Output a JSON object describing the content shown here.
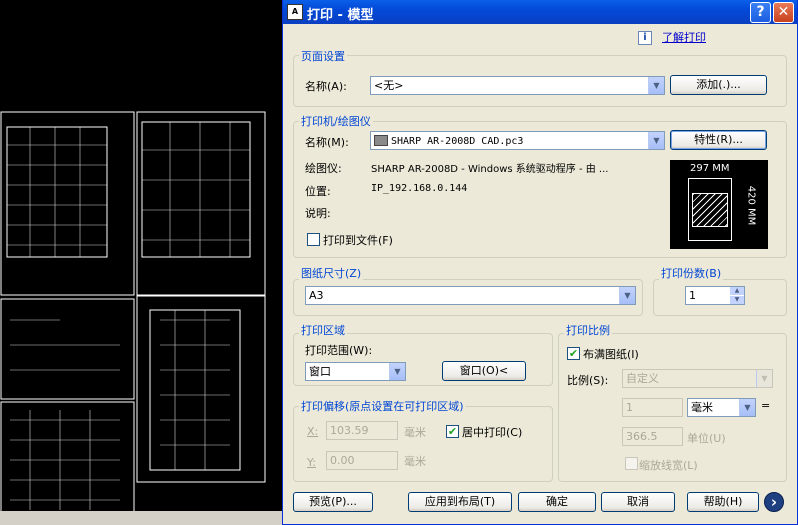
{
  "window": {
    "title": "打印 - 模型",
    "help_symbol": "?",
    "close_symbol": "✕",
    "app_icon_text": "A"
  },
  "learn": {
    "icon": "i",
    "link": "了解打印"
  },
  "page_setup": {
    "title": "页面设置",
    "name_label": "名称(A):",
    "name_value": "<无>",
    "add_button": "添加(.)..."
  },
  "printer": {
    "title": "打印机/绘图仪",
    "name_label": "名称(M):",
    "name_value": "SHARP AR-2008D CAD.pc3",
    "properties_button": "特性(R)...",
    "plotter_label": "绘图仪:",
    "plotter_value": "SHARP AR-2008D - Windows 系统驱动程序 - 由 ...",
    "location_label": "位置:",
    "location_value": "IP_192.168.0.144",
    "desc_label": "说明:",
    "print_to_file": "打印到文件(F)",
    "print_to_file_checked": false,
    "preview_width": "297 MM",
    "preview_height": "420 MM"
  },
  "paper_size": {
    "title": "图纸尺寸(Z)",
    "value": "A3"
  },
  "copies": {
    "title": "打印份数(B)",
    "value": "1"
  },
  "plot_area": {
    "title": "打印区域",
    "range_label": "打印范围(W):",
    "range_value": "窗口",
    "window_button": "窗口(O)<"
  },
  "plot_offset": {
    "title": "打印偏移(原点设置在可打印区域)",
    "x_label": "X:",
    "x_value": "103.59",
    "x_unit": "毫米",
    "y_label": "Y:",
    "y_value": "0.00",
    "y_unit": "毫米",
    "center_label": "居中打印(C)",
    "center_checked": true
  },
  "plot_scale": {
    "title": "打印比例",
    "fit_label": "布满图纸(I)",
    "fit_checked": true,
    "scale_label": "比例(S):",
    "scale_value": "自定义",
    "num_value": "1",
    "unit_value": "毫米",
    "equals": "=",
    "den_value": "366.5",
    "den_unit": "单位(U)",
    "lineweight_label": "缩放线宽(L)",
    "lineweight_checked": false
  },
  "footer": {
    "preview_button": "预览(P)...",
    "apply_button": "应用到布局(T)",
    "ok_button": "确定",
    "cancel_button": "取消",
    "help_button": "帮助(H)",
    "more_symbol": "›"
  }
}
